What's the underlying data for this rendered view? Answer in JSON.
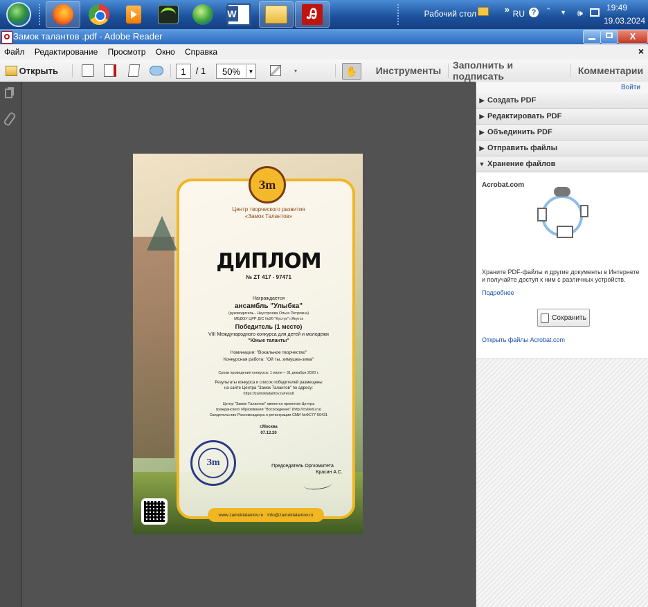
{
  "taskbar": {
    "apps": [
      {
        "name": "start-orb-icon"
      },
      {
        "name": "firefox-icon"
      },
      {
        "name": "chrome-icon"
      },
      {
        "name": "media-player-icon"
      },
      {
        "name": "network-meter-icon"
      },
      {
        "name": "browser-globe-icon"
      },
      {
        "name": "word-icon",
        "label": "W"
      },
      {
        "name": "folder-icon"
      },
      {
        "name": "acrobat-icon"
      }
    ],
    "desktop_label": "Рабочий стол",
    "lang": "RU",
    "time": "19:49",
    "date": "19.03.2024"
  },
  "window": {
    "title": "Замок талантов .pdf - Adobe Reader",
    "close_x": "×"
  },
  "menu": [
    "Файл",
    "Редактирование",
    "Просмотр",
    "Окно",
    "Справка"
  ],
  "toolbar": {
    "open_label": "Открыть",
    "page_current": "1",
    "page_total": "/ 1",
    "zoom": "50%",
    "tools": "Инструменты",
    "fill_sign": "Заполнить и подписать",
    "comments": "Комментарии"
  },
  "rightpane": {
    "login": "Войти",
    "sections": [
      {
        "label": "Создать PDF",
        "arrow": "▶"
      },
      {
        "label": "Редактировать PDF",
        "arrow": "▶"
      },
      {
        "label": "Объединить PDF",
        "arrow": "▶"
      },
      {
        "label": "Отправить файлы",
        "arrow": "▶"
      },
      {
        "label": "Хранение файлов",
        "arrow": "▼"
      }
    ],
    "panel": {
      "heading": "Acrobat.com",
      "desc": "Храните PDF-файлы и другие документы в Интернете и получайте доступ к ним с различных устройств.",
      "more": "Подробнее",
      "save": "Сохранить",
      "open_link": "Открыть файлы Acrobat.com"
    }
  },
  "certificate": {
    "org_line1": "Центр творческого развития",
    "org_line2": "«Замок Талантов»",
    "title": "ДИПЛОМ",
    "number": "№ ZT 417 - 97471",
    "awarded": "Награждается",
    "recipient": "ансамбль \"Улыбка\"",
    "leader": "(руководитель - Неустроева Ольга Петровна)",
    "school": "МБДОУ ЦРР Д/С №26 \"Кустук\" г.Якутск",
    "place": "Победитель (1 место)",
    "contest1": "VIII Международного конкурса для детей и молодежи",
    "contest2": "\"Юные таланты\"",
    "nomination": "Номинация: \"Вокальное творчество\"",
    "work": "Конкурсная работа: \"Ой ты, зимушка-зима\"",
    "dates": "Сроки проведения конкурса: 1 июля – 31 декабря 2020 г.",
    "results1": "Результаты конкурса и список победителей размещены",
    "results2": "на сайте Центра \"Замок Талантов\" по адресу:",
    "results3": "https://zamoktalantov.ru/result",
    "proj1": "Центр \"Замок Талантов\" является проектом Центра",
    "proj2": "гражданского образования \"Восхождение\" (http://civiledu.ru)",
    "proj3": "Свидетельство Роскомнадзора о регистрации СМИ №ФС77-56431",
    "city": "г.Москва",
    "date": "07.12.20",
    "chair1": "Председатель Оргкомитета",
    "chair2": "Красин А.С.",
    "web": "www.zamoktalantov.ru",
    "email": "info@zamoktalantov.ru",
    "logo_text": "Зm"
  }
}
